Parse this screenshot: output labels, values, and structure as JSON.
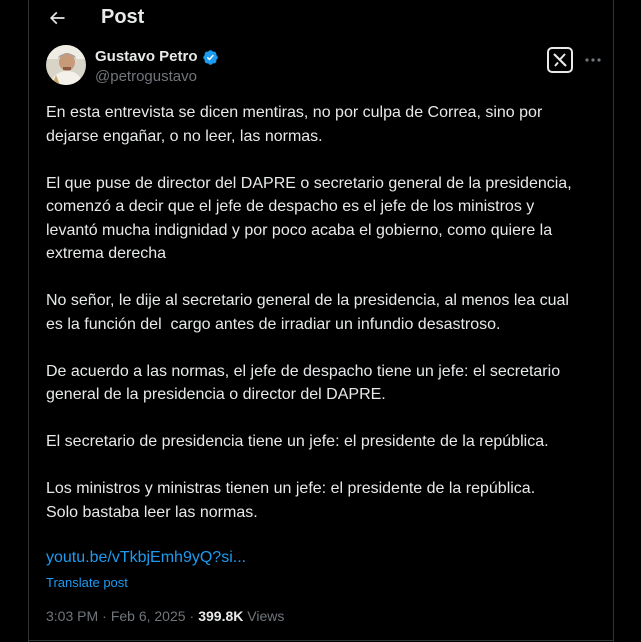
{
  "header": {
    "title": "Post",
    "back_icon": "arrow-left-icon"
  },
  "author": {
    "name": "Gustavo Petro",
    "handle": "@petrogustavo",
    "verified_icon": "verified-badge-icon",
    "verified_color": "#1d9bf0"
  },
  "actions": {
    "grok_icon": "grok-icon",
    "more_icon": "more-horizontal-icon"
  },
  "post": {
    "paragraphs": [
      "En esta entrevista se dicen mentiras, no por culpa de Correa, sino por\ndejarse engañar, o no leer, las normas.",
      "El que puse de director del DAPRE o secretario general de la presidencia,\ncomenzó a decir que el jefe de despacho es el jefe de los ministros y\nlevantó mucha indignidad y por poco acaba el gobierno, como quiere la\nextrema derecha",
      "No señor, le dije al secretario general de la presidencia, al menos lea cual\nes la función del  cargo antes de irradiar un infundio desastroso.",
      "De acuerdo a las normas, el jefe de despacho tiene un jefe: el secretario\ngeneral de la presidencia o director del DAPRE.",
      "El secretario de presidencia tiene un jefe: el presidente de la república.",
      "Los ministros y ministras tienen un jefe: el presidente de la república.\nSolo bastaba leer las normas."
    ],
    "link": "youtu.be/vTkbjEmh9yQ?si...",
    "translate_label": "Translate post"
  },
  "meta": {
    "time": "3:03 PM",
    "separator": "·",
    "date": "Feb 6, 2025",
    "separator2": "·",
    "views_count": "399.8K",
    "views_label": "Views"
  },
  "colors": {
    "background": "#000000",
    "text": "#e7e9ea",
    "muted": "#71767b",
    "link": "#1d9bf0",
    "border": "#2f3336"
  }
}
